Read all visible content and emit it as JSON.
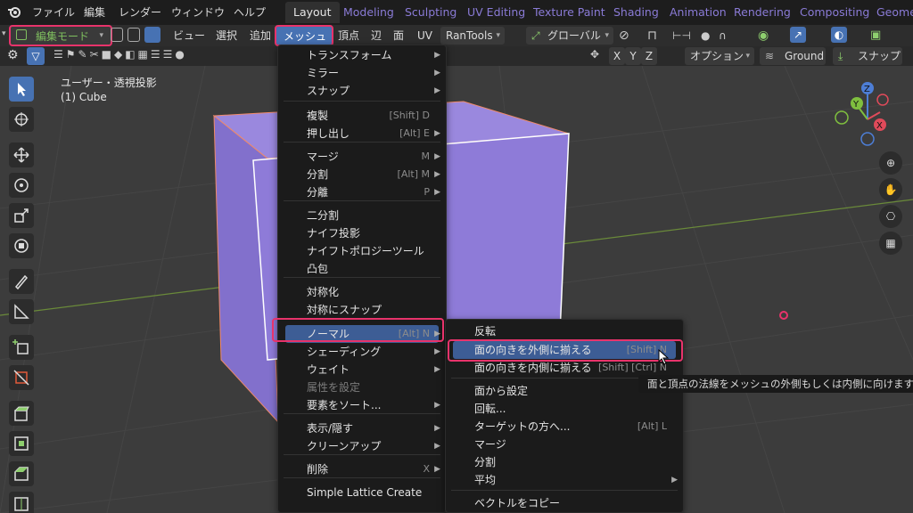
{
  "topbar": {
    "menus": [
      "ファイル",
      "編集",
      "レンダー",
      "ウィンドウ",
      "ヘルプ"
    ],
    "workspaces": [
      "Layout",
      "Modeling",
      "Sculpting",
      "UV Editing",
      "Texture Paint",
      "Shading",
      "Animation",
      "Rendering",
      "Compositing",
      "Geomet"
    ],
    "active_workspace": "Layout"
  },
  "header": {
    "mode": "編集モード",
    "menus": [
      "ビュー",
      "選択",
      "追加",
      "メッシュ",
      "頂点",
      "辺",
      "面",
      "UV"
    ],
    "addon": "RanTools",
    "orientation": "グローバル"
  },
  "toolbar2": {
    "axes": [
      "X",
      "Y",
      "Z"
    ],
    "options": "オプション",
    "ground": "Ground",
    "snap": "スナップ"
  },
  "viewport": {
    "view_name": "ユーザー・透視投影",
    "object_name": "(1) Cube",
    "gizmo": {
      "z": "Z",
      "y": "Y",
      "x": "X"
    }
  },
  "mesh_menu": {
    "items": [
      {
        "label": "トランスフォーム",
        "shortcut": "",
        "submenu": true
      },
      {
        "label": "ミラー",
        "shortcut": "",
        "submenu": true
      },
      {
        "label": "スナップ",
        "shortcut": "",
        "submenu": true
      },
      {
        "label": "複製",
        "shortcut": "[Shift] D",
        "submenu": false
      },
      {
        "label": "押し出し",
        "shortcut": "[Alt] E",
        "submenu": true
      },
      {
        "label": "マージ",
        "shortcut": "M",
        "submenu": true
      },
      {
        "label": "分割",
        "shortcut": "[Alt] M",
        "submenu": true
      },
      {
        "label": "分離",
        "shortcut": "P",
        "submenu": true
      },
      {
        "label": "二分割",
        "shortcut": "",
        "submenu": false
      },
      {
        "label": "ナイフ投影",
        "shortcut": "",
        "submenu": false
      },
      {
        "label": "ナイフトポロジーツール",
        "shortcut": "",
        "submenu": false
      },
      {
        "label": "凸包",
        "shortcut": "",
        "submenu": false
      },
      {
        "label": "対称化",
        "shortcut": "",
        "submenu": false
      },
      {
        "label": "対称にスナップ",
        "shortcut": "",
        "submenu": false
      },
      {
        "label": "ノーマル",
        "shortcut": "[Alt] N",
        "submenu": true
      },
      {
        "label": "シェーディング",
        "shortcut": "",
        "submenu": true
      },
      {
        "label": "ウェイト",
        "shortcut": "",
        "submenu": true
      },
      {
        "label": "属性を設定",
        "shortcut": "",
        "submenu": false
      },
      {
        "label": "要素をソート...",
        "shortcut": "",
        "submenu": true
      },
      {
        "label": "表示/隠す",
        "shortcut": "",
        "submenu": true
      },
      {
        "label": "クリーンアップ",
        "shortcut": "",
        "submenu": true
      },
      {
        "label": "削除",
        "shortcut": "X",
        "submenu": true
      },
      {
        "label": "Simple Lattice Create",
        "shortcut": "",
        "submenu": false
      }
    ]
  },
  "normals_menu": {
    "items": [
      {
        "label": "反転",
        "shortcut": "",
        "submenu": false
      },
      {
        "label": "面の向きを外側に揃える",
        "shortcut": "[Shift] N",
        "submenu": false
      },
      {
        "label": "面の向きを内側に揃える",
        "shortcut": "[Shift] [Ctrl] N",
        "submenu": false
      },
      {
        "label": "面から設定",
        "shortcut": "",
        "submenu": false
      },
      {
        "label": "回転...",
        "shortcut": "",
        "submenu": false
      },
      {
        "label": "ターゲットの方へ...",
        "shortcut": "[Alt] L",
        "submenu": false
      },
      {
        "label": "マージ",
        "shortcut": "",
        "submenu": false
      },
      {
        "label": "分割",
        "shortcut": "",
        "submenu": false
      },
      {
        "label": "平均",
        "shortcut": "",
        "submenu": true
      },
      {
        "label": "ベクトルをコピー",
        "shortcut": "",
        "submenu": false
      }
    ]
  },
  "tooltip": "面と頂点の法線をメッシュの外側もしくは内側に向けます。",
  "colors": {
    "highlight": "#e8336b",
    "cube_face": "#8e7bd8",
    "active_tab_text": "#e6e6e6",
    "workspace_tab_text": "#8a7bd6"
  }
}
